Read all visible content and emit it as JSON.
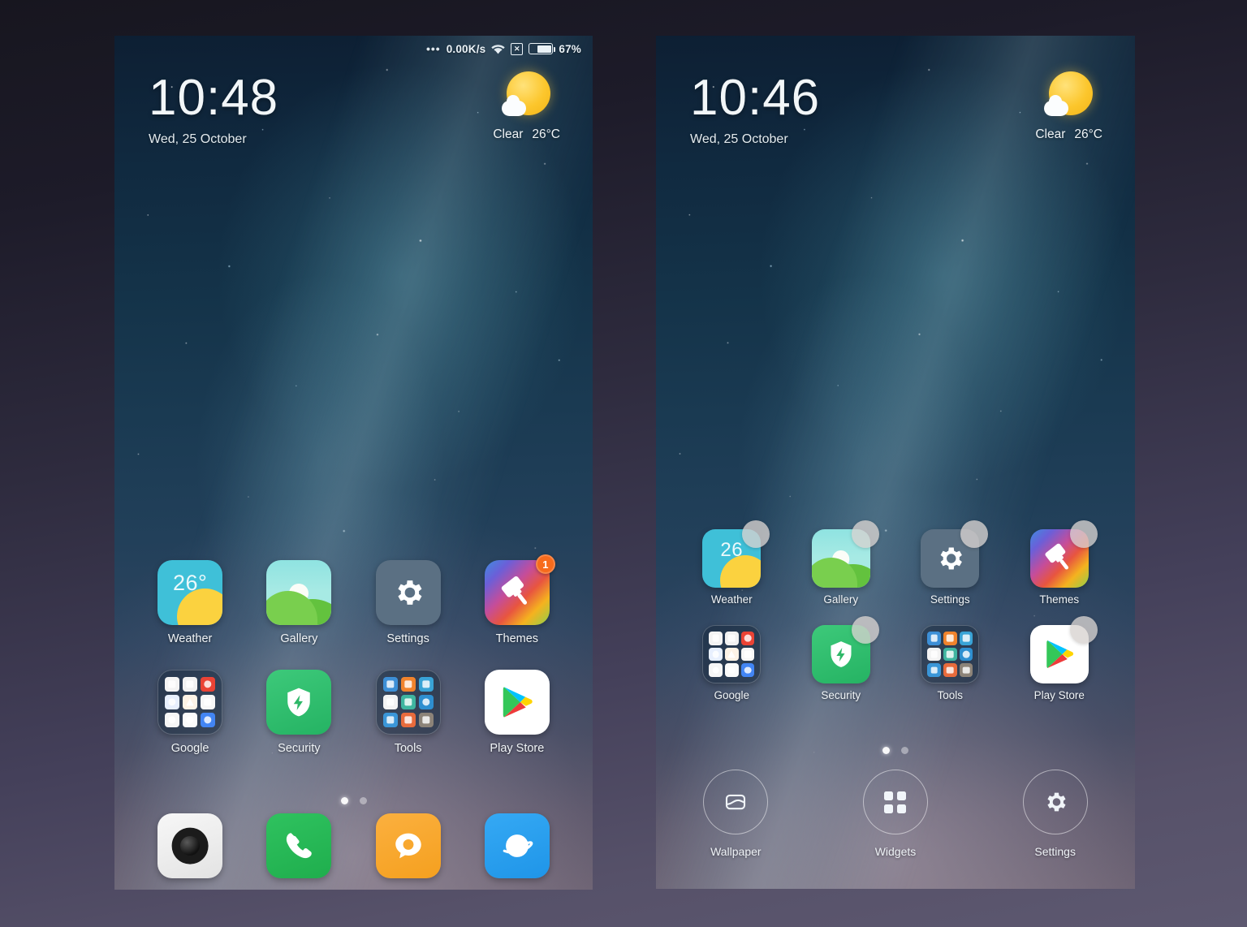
{
  "theme": {
    "page_bg_top": "#17161f",
    "page_bg_bottom": "#5d5870",
    "badge_color": "#f76b1c",
    "weather_icon_bg": "#3fc0d8",
    "security_icon_bg": "#2eb868",
    "settings_icon_bg": "#5b7083"
  },
  "phones": [
    {
      "id": "home-screen",
      "status_bar": {
        "dots": "•••",
        "network_speed": "0.00K/s",
        "wifi_icon": "wifi-icon",
        "sim_icon": "no-sim-icon",
        "sim_glyph": "✕",
        "battery_icon": "battery-icon",
        "battery_percent": "67%",
        "battery_level": 67
      },
      "clock": {
        "time": "10:48",
        "date": "Wed, 25 October"
      },
      "weather": {
        "condition": "Clear",
        "temperature": "26°C",
        "icon": "sun-behind-cloud-icon"
      },
      "apps": [
        {
          "name": "Weather",
          "icon": "weather-icon",
          "badge": null,
          "temp": "26°"
        },
        {
          "name": "Gallery",
          "icon": "gallery-icon",
          "badge": null
        },
        {
          "name": "Settings",
          "icon": "settings-gear-icon",
          "badge": null
        },
        {
          "name": "Themes",
          "icon": "themes-brush-icon",
          "badge": "1"
        },
        {
          "name": "Google",
          "icon": "google-folder-icon",
          "badge": null
        },
        {
          "name": "Security",
          "icon": "security-shield-icon",
          "badge": null
        },
        {
          "name": "Tools",
          "icon": "tools-folder-icon",
          "badge": null
        },
        {
          "name": "Play Store",
          "icon": "play-store-icon",
          "badge": null
        }
      ],
      "page_dots": {
        "count": 2,
        "active": 0
      },
      "dock": [
        {
          "name": "Camera",
          "icon": "camera-icon"
        },
        {
          "name": "Phone",
          "icon": "phone-handset-icon"
        },
        {
          "name": "Messaging",
          "icon": "message-bubble-icon"
        },
        {
          "name": "Browser",
          "icon": "browser-planet-icon"
        }
      ]
    },
    {
      "id": "edit-mode-screen",
      "clock": {
        "time": "10:46",
        "date": "Wed, 25 October"
      },
      "weather": {
        "condition": "Clear",
        "temperature": "26°C",
        "icon": "sun-behind-cloud-icon"
      },
      "apps": [
        {
          "name": "Weather",
          "icon": "weather-icon",
          "selectable": true,
          "temp": "26"
        },
        {
          "name": "Gallery",
          "icon": "gallery-icon",
          "selectable": true
        },
        {
          "name": "Settings",
          "icon": "settings-gear-icon",
          "selectable": true
        },
        {
          "name": "Themes",
          "icon": "themes-brush-icon",
          "selectable": true
        },
        {
          "name": "Google",
          "icon": "google-folder-icon",
          "selectable": false
        },
        {
          "name": "Security",
          "icon": "security-shield-icon",
          "selectable": true
        },
        {
          "name": "Tools",
          "icon": "tools-folder-icon",
          "selectable": false
        },
        {
          "name": "Play Store",
          "icon": "play-store-icon",
          "selectable": true
        }
      ],
      "page_dots": {
        "count": 2,
        "active": 0
      },
      "edit_toolbar": [
        {
          "label": "Wallpaper",
          "icon": "wallpaper-image-icon"
        },
        {
          "label": "Widgets",
          "icon": "widgets-grid-icon"
        },
        {
          "label": "Settings",
          "icon": "settings-gear-icon"
        }
      ]
    }
  ]
}
